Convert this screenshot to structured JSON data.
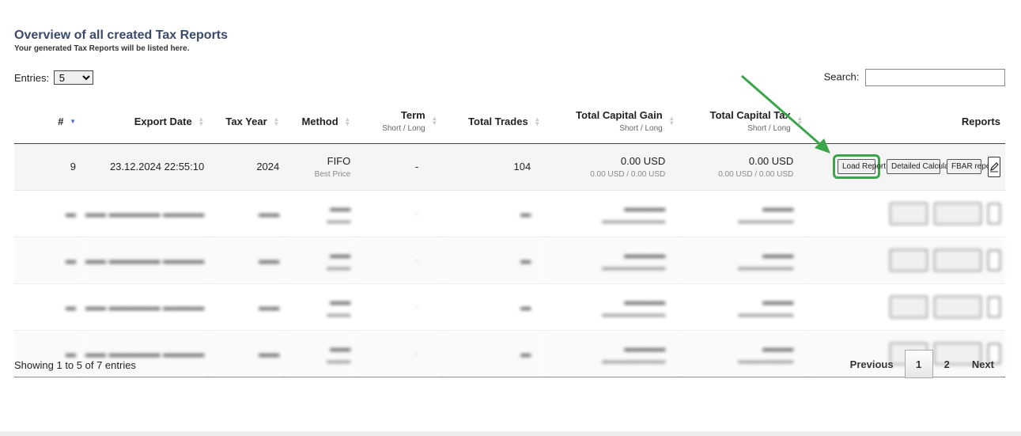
{
  "header": {
    "title": "Overview of all created Tax Reports",
    "subtitle": "Your generated Tax Reports will be listed here."
  },
  "controls": {
    "entries_label": "Entries:",
    "entries_value": "5",
    "search_label": "Search:",
    "search_value": ""
  },
  "columns": {
    "num": "#",
    "export_date": "Export Date",
    "tax_year": "Tax Year",
    "method": "Method",
    "term": "Term",
    "term_sub": "Short / Long",
    "total_trades": "Total Trades",
    "capital_gain": "Total Capital Gain",
    "capital_gain_sub": "Short / Long",
    "capital_tax": "Total Capital Tax",
    "capital_tax_sub": "Short / Long",
    "reports": "Reports"
  },
  "rows": [
    {
      "num": "9",
      "export_date": "23.12.2024 22:55:10",
      "tax_year": "2024",
      "method": "FIFO",
      "method_sub": "Best Price",
      "term": "-",
      "trades": "104",
      "gain": "0.00 USD",
      "gain_sub": "0.00 USD / 0.00 USD",
      "tax": "0.00 USD",
      "tax_sub": "0.00 USD / 0.00 USD"
    }
  ],
  "buttons": {
    "load_report": "Load Report",
    "detailed_calculation": "Detailed Calculation",
    "fbar_report": "FBAR report"
  },
  "footer": {
    "info": "Showing 1 to 5 of 7 entries",
    "previous": "Previous",
    "page1": "1",
    "page2": "2",
    "next": "Next"
  },
  "colors": {
    "accent": "#3a4a6b",
    "highlight": "#3aa54a",
    "sort_active": "#4a6fc4"
  }
}
